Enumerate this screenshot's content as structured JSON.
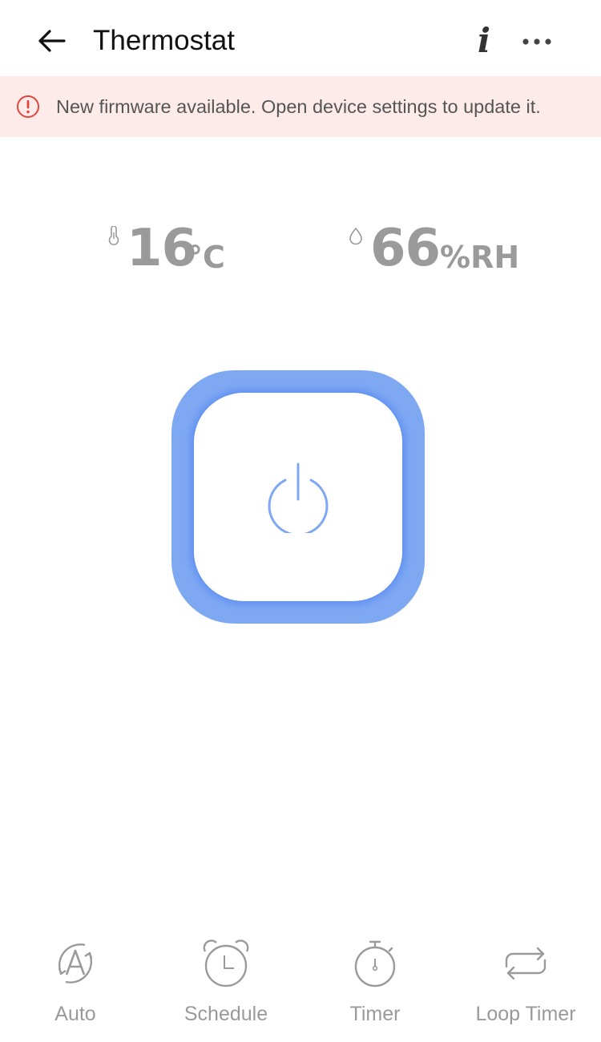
{
  "header": {
    "title": "Thermostat",
    "back_icon": "arrow-left-icon",
    "info_icon": "info-icon",
    "info_glyph": "i",
    "more_icon": "more-horizontal-icon"
  },
  "banner": {
    "icon": "alert-circle-icon",
    "text": "New firmware available. Open device settings to update it.",
    "background": "#fdebea",
    "icon_color": "#e0463c"
  },
  "readings": {
    "temperature": {
      "icon": "thermometer-icon",
      "value": "16",
      "unit": "°C"
    },
    "humidity": {
      "icon": "water-drop-icon",
      "value": "66",
      "unit": "%RH"
    }
  },
  "power": {
    "icon": "power-icon",
    "accent": "#7fa8f3"
  },
  "bottom_tabs": [
    {
      "label": "Auto",
      "icon": "auto-mode-icon"
    },
    {
      "label": "Schedule",
      "icon": "alarm-clock-icon"
    },
    {
      "label": "Timer",
      "icon": "stopwatch-icon"
    },
    {
      "label": "Loop Timer",
      "icon": "loop-icon"
    }
  ]
}
